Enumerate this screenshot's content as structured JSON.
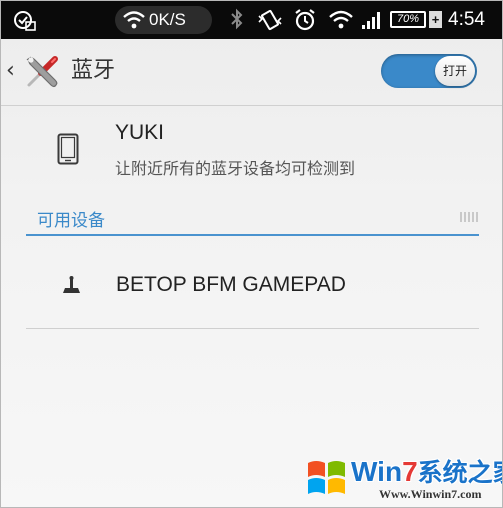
{
  "status_bar": {
    "net_speed": "0K/S",
    "battery_percent": "70%",
    "battery_charging_symbol": "+",
    "time": "4:54",
    "icons": [
      "alarm-clock-check-icon",
      "wifi-icon",
      "bluetooth-icon",
      "vibrate-icon",
      "alarm-icon",
      "wifi-icon",
      "signal-icon",
      "battery-icon"
    ]
  },
  "header": {
    "back_symbol": "‹",
    "title": "蓝牙",
    "toggle_label": "打开",
    "toggle_on": true
  },
  "this_device": {
    "name": "YUKI",
    "status": "让附近所有的蓝牙设备均可检测到"
  },
  "available_section": {
    "label": "可用设备"
  },
  "devices": [
    {
      "name": "BETOP BFM GAMEPAD",
      "icon": "joystick-icon"
    }
  ],
  "watermark": {
    "brand_a": "Win",
    "brand_b": "7",
    "brand_c": "系统之家",
    "url": "Www.Winwin7.com"
  },
  "colors": {
    "accent": "#3a89c9",
    "status_bar": "#0a0a0a"
  }
}
